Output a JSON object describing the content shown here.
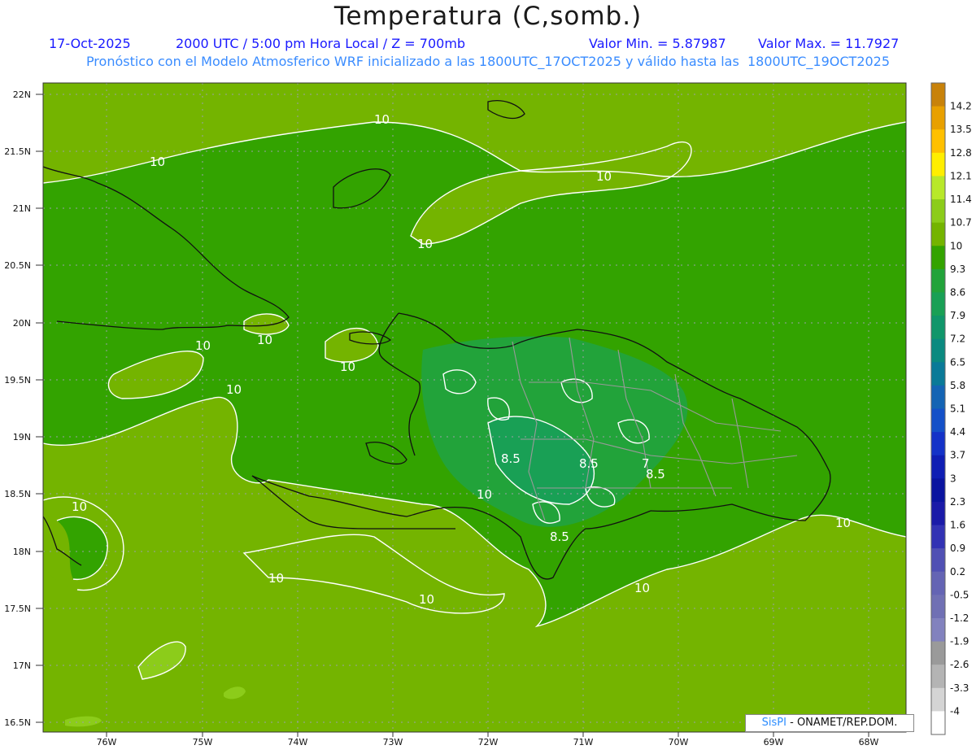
{
  "header": {
    "title": "Temperatura (C,somb.)",
    "date": "17-Oct-2025",
    "time": "2000 UTC / 5:00 pm Hora Local / Z = 700mb",
    "min_value": "Valor Min. = 5.87987",
    "max_value": "Valor Max. = 11.7927",
    "forecast_info": "Pronóstico con el Modelo Atmosferico WRF inicializado a las 1800UTC_17OCT2025 y válido hasta las  1800UTC_19OCT2025"
  },
  "credit": {
    "brand": "SisPI",
    "text": " - ONAMET/REP.DOM."
  },
  "axes": {
    "lat_labels": [
      "22N",
      "21.5N",
      "21N",
      "20.5N",
      "20N",
      "19.5N",
      "19N",
      "18.5N",
      "18N",
      "17.5N",
      "17N",
      "16.5N"
    ],
    "lon_labels": [
      "76W",
      "75W",
      "74W",
      "73W",
      "72W",
      "71W",
      "70W",
      "69W",
      "68W"
    ]
  },
  "colorbar": {
    "labels": [
      "14.2",
      "13.5",
      "12.8",
      "12.1",
      "11.4",
      "10.7",
      "10",
      "9.3",
      "8.6",
      "7.9",
      "7.2",
      "6.5",
      "5.8",
      "5.1",
      "4.4",
      "3.7",
      "3",
      "2.3",
      "1.6",
      "0.9",
      "0.2",
      "-0.5",
      "-1.2",
      "-1.9",
      "-2.6",
      "-3.3",
      "-4"
    ],
    "colors": [
      "#c8820a",
      "#e8a000",
      "#ffc000",
      "#ffee00",
      "#b8e82a",
      "#8ccc1a",
      "#74b400",
      "#33a300",
      "#22a33a",
      "#19a055",
      "#10966a",
      "#0b8a80",
      "#0a7a98",
      "#1464b4",
      "#1450c8",
      "#1432c8",
      "#0f1eb4",
      "#0a14a0",
      "#1a1aa8",
      "#3232b4",
      "#5050b4",
      "#6464b4",
      "#7070b4",
      "#8282be",
      "#9a9a9a",
      "#b4b4b4",
      "#d4d4d4",
      "#ffffff"
    ]
  },
  "contour_labels": [
    "10",
    "10",
    "10",
    "10",
    "10",
    "10",
    "10",
    "10",
    "10",
    "10",
    "10",
    "10",
    "10",
    "10",
    "8.5",
    "8.5",
    "8.5",
    "7",
    "8.5"
  ],
  "chart_data": {
    "type": "heatmap",
    "title": "Temperatura (C,somb.)",
    "variable": "Temperature at 700mb (C)",
    "lat_range": [
      "16.5N",
      "22N"
    ],
    "lon_range": [
      "76W",
      "68W"
    ],
    "min": 5.87987,
    "max": 11.7927,
    "contour_levels": [
      7,
      8.5,
      10
    ]
  }
}
